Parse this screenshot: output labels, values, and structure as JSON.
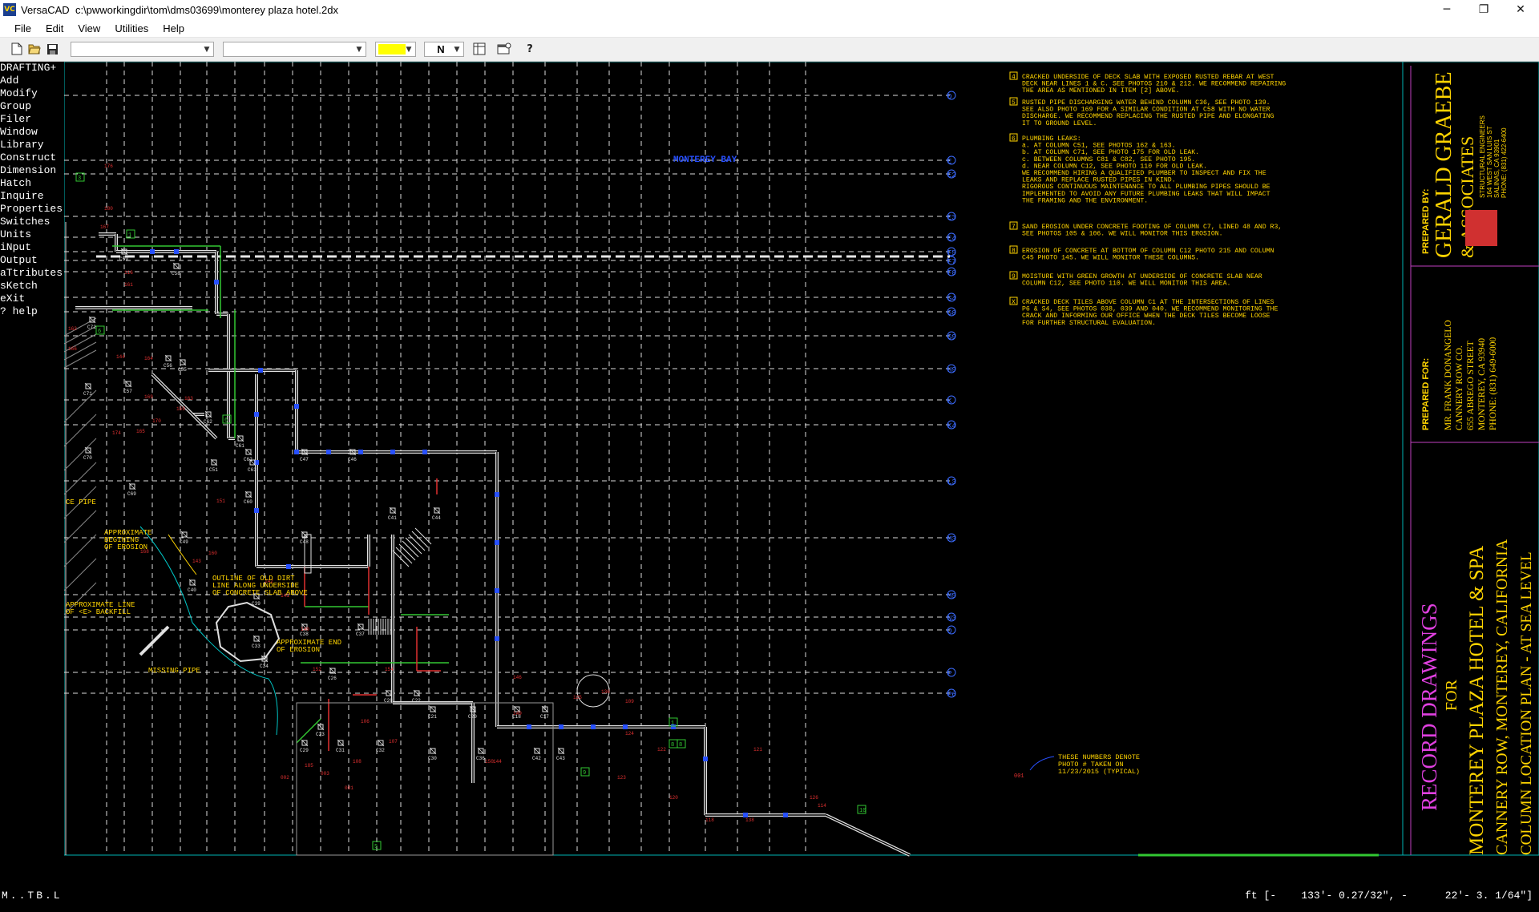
{
  "window": {
    "app_name": "VersaCAD",
    "file_path": "c:\\pwworkingdir\\tom\\dms03699\\monterey plaza hotel.2dx",
    "controls": [
      "─",
      "❐",
      "✕"
    ]
  },
  "menubar": [
    "File",
    "Edit",
    "View",
    "Utilities",
    "Help"
  ],
  "toolbar": {
    "icons": [
      "new-file-icon",
      "open-folder-icon",
      "save-icon",
      "layers-icon",
      "window-settings-icon",
      "help-icon"
    ],
    "active_color": "#ffff00",
    "layer_label": "N"
  },
  "side_menu": {
    "header": "DRAFTING+",
    "items": [
      "Add",
      "Modify",
      "Group",
      "Filer",
      "Window",
      "Library",
      "Construct",
      "Dimension",
      "Hatch",
      "Inquire",
      "Properties",
      "Switches",
      "Units",
      "iNput",
      "Output",
      "aTtributes",
      "sKetch",
      "eXit",
      "? help"
    ]
  },
  "drawing": {
    "area_label": "MONTEREY BAY",
    "grid_labels_right": [
      "D",
      "E",
      "E2",
      "E3",
      "E4",
      "F5",
      "F7",
      "F8",
      "G4",
      "G8",
      "G9",
      "H9",
      "K",
      "K4",
      "L3",
      "M3",
      "M5",
      "N3",
      "O",
      "P",
      "P6"
    ],
    "notes": [
      {
        "num": "4",
        "lines": [
          "CRACKED UNDERSIDE OF DECK SLAB WITH EXPOSED RUSTED REBAR AT WEST",
          "DECK NEAR LINES 1 & C. SEE PHOTOS 210 & 212.  WE RECOMMEND REPAIRING",
          "THE AREA AS MENTIONED IN ITEM [2] ABOVE."
        ]
      },
      {
        "num": "5",
        "lines": [
          "RUSTED PIPE DISCHARGING WATER BEHIND COLUMN C36, SEE PHOTO 139.",
          "SEE ALSO PHOTO 169 FOR A SIMILAR CONDITION AT C58 WITH NO WATER",
          "DISCHARGE.  WE RECOMMEND REPLACING THE RUSTED PIPE AND ELONGATING",
          "IT TO GROUND LEVEL."
        ]
      },
      {
        "num": "6",
        "lines": [
          "PLUMBING LEAKS:",
          "a. AT COLUMN C51, SEE PHOTOS 162 & 163.",
          "b. AT COLUMN C71, SEE PHOTO 175 FOR OLD LEAK.",
          "c. BETWEEN COLUMNS C81 & C82, SEE PHOTO 195.",
          "d. NEAR COLUMN C12, SEE PHOTO 110 FOR OLD LEAK.",
          "WE RECOMMEND HIRING A QUALIFIED PLUMBER TO INSPECT AND FIX THE",
          "LEAKS AND REPLACE RUSTED PIPES IN KIND.",
          "RIGOROUS CONTINUOUS MAINTENANCE TO ALL PLUMBING PIPES SHOULD BE",
          "IMPLEMENTED TO AVOID ANY FUTURE PLUMBING LEAKS THAT WILL IMPACT",
          "THE FRAMING AND THE ENVIRONMENT."
        ]
      },
      {
        "num": "7",
        "lines": [
          "SAND EROSION UNDER CONCRETE FOOTING OF COLUMN C7,  LINED 48 AND R3,",
          "SEE PHOTOS 105 & 106.  WE WILL MONITOR THIS EROSION."
        ]
      },
      {
        "num": "8",
        "lines": [
          "EROSION OF CONCRETE AT BOTTOM OF COLUMN C12 PHOTO 215 AND COLUMN",
          "C45 PHOTO 145.  WE WILL MONITOR THESE COLUMNS."
        ]
      },
      {
        "num": "9",
        "lines": [
          "MOISTURE WITH GREEN GROWTH AT UNDERSIDE OF CONCRETE SLAB NEAR",
          "COLUMN C12, SEE PHOTO 110.  WE WILL MONITOR THIS AREA."
        ]
      },
      {
        "num": "X",
        "lines": [
          "CRACKED DECK TILES ABOVE COLUMN C1 AT THE INTERSECTIONS OF LINES",
          "P6 & S4, SEE PHOTOS 038, 039 AND 040. WE RECOMMEND MONITORING THE",
          "CRACK AND INFORMING OUR OFFICE WHEN THE DECK TILES BECOME LOOSE",
          "FOR FURTHER STRUCTURAL EVALUATION."
        ]
      }
    ],
    "legend_note": [
      "THESE NUMBERS DENOTE",
      "PHOTO # TAKEN ON",
      "11/23/2015 (TYPICAL)"
    ],
    "legend_sample": "001",
    "annotations": [
      {
        "lines": [
          "APPROXIMATE",
          "BEGINING",
          "OF EROSION"
        ]
      },
      {
        "lines": [
          "OUTLINE OF OLD DIRT",
          "LINE ALONG UNDERSIDE",
          "OF CONCRETE SLAB ABOVE"
        ]
      },
      {
        "lines": [
          "APPROXIMATE LINE",
          "OF <E> BACKFILL"
        ]
      },
      {
        "lines": [
          "APPROXIMATE END",
          "OF EROSION"
        ]
      },
      {
        "lines": [
          "MISSING PIPE"
        ]
      },
      {
        "lines": [
          "CE PIPE"
        ]
      }
    ],
    "columns": [
      "C59",
      "C58",
      "C72",
      "C56",
      "C55",
      "C71",
      "C57",
      "C70",
      "C69",
      "C51",
      "C62",
      "C61",
      "C63",
      "C62",
      "C47",
      "C46",
      "C60",
      "C49",
      "C48",
      "C41",
      "C44",
      "C40",
      "C39",
      "C38",
      "C37",
      "C33",
      "C34",
      "C26",
      "C28",
      "C22",
      "C21",
      "C20",
      "C18",
      "C17",
      "C23",
      "C29",
      "C31",
      "C32",
      "C30",
      "C36",
      "C42",
      "C43"
    ],
    "photo_numbers": [
      "176",
      "180",
      "167",
      "116",
      "161",
      "162",
      "166",
      "144",
      "164",
      "169",
      "170",
      "174",
      "165",
      "163",
      "159",
      "151",
      "160",
      "168",
      "143",
      "142",
      "141",
      "140",
      "152",
      "154",
      "150",
      "144",
      "149",
      "146",
      "136",
      "125",
      "124",
      "122",
      "123",
      "121",
      "120",
      "118",
      "138",
      "126",
      "114",
      "109",
      "106",
      "107",
      "108",
      "185",
      "002",
      "003",
      "001"
    ],
    "title_block": {
      "prepared_by_label": "PREPARED BY:",
      "firm_name": "GERALD GRAEBE",
      "firm_name_2": "& ASSOCIATES",
      "firm_lines": [
        "STRUCTURAL ENGINEERS",
        "164 WEST SAN LUIS ST",
        "SALINAS, CA 93901",
        "PHONE: (831) 422-6400"
      ],
      "prepared_for_label": "PREPARED FOR:",
      "client_lines": [
        "MR. FRANK DONANGELO",
        "CANNERY ROW CO.",
        "655 ABREGO STREET",
        "MONTEREY, CA 93940",
        "PHONE: (831) 649-6000"
      ],
      "drawing_title": "RECORD DRAWINGS",
      "drawing_for": "FOR",
      "project_lines": [
        "MONTEREY PLAZA HOTEL & SPA",
        "CANNERY ROW, MONTEREY, CALIFORNIA",
        "COLUMN LOCATION PLAN - AT SEA LEVEL"
      ]
    }
  },
  "status": {
    "left": "M..TB.L",
    "units": "ft [-",
    "x": "133'- 0.27/32\", -",
    "y": "22'- 3. 1/64\"]"
  }
}
